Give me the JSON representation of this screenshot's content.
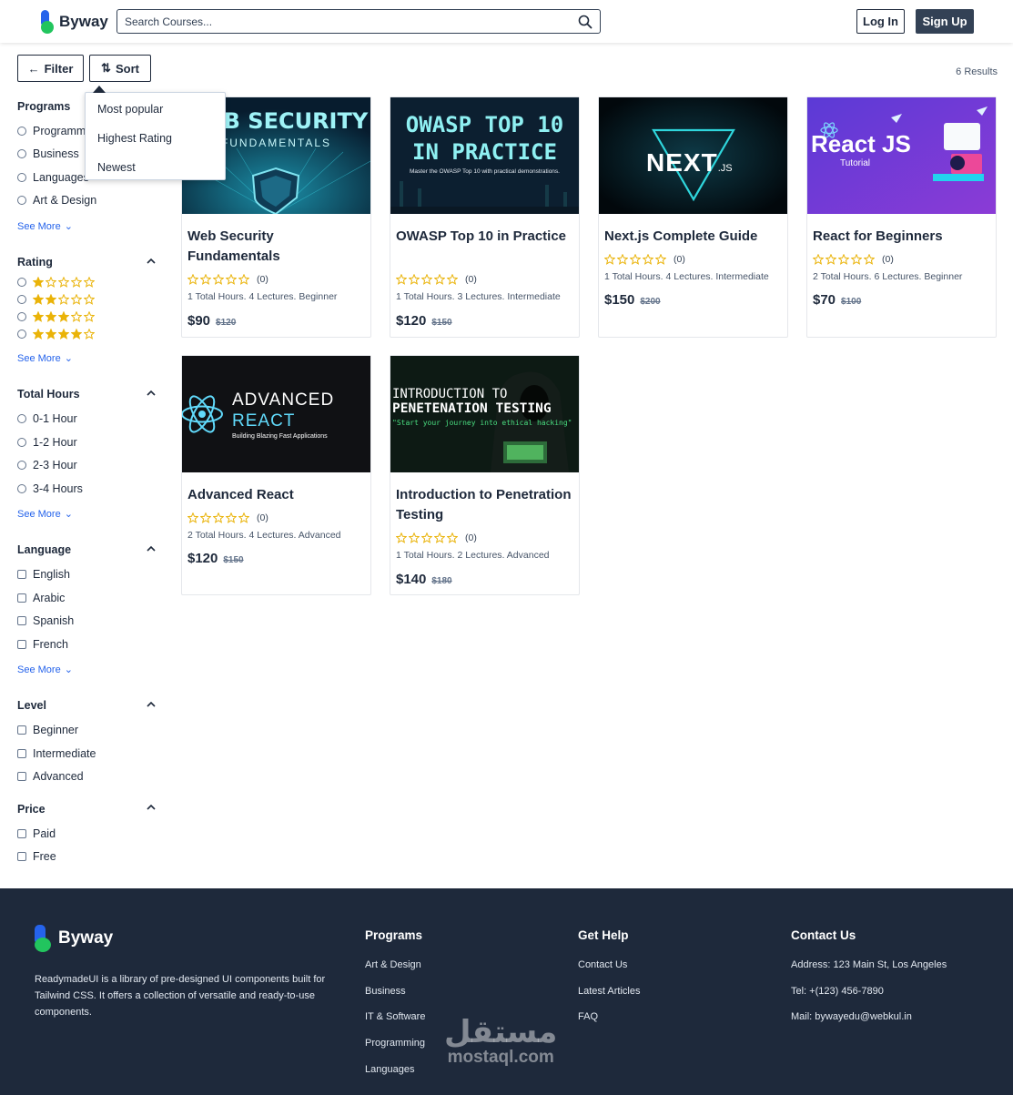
{
  "header": {
    "logo_text": "Byway",
    "search_placeholder": "Search Courses...",
    "login_label": "Log In",
    "signup_label": "Sign Up"
  },
  "toolbar": {
    "filter_label": "Filter",
    "sort_label": "Sort",
    "results": "6 Results"
  },
  "sort_menu": [
    "Most popular",
    "Highest Rating",
    "Newest"
  ],
  "sidebar": {
    "programs": {
      "title": "Programs",
      "options": [
        "Programming",
        "Business",
        "Languages",
        "Art & Design"
      ],
      "see_more": "See More"
    },
    "rating": {
      "title": "Rating",
      "levels": [
        1,
        2,
        3,
        4
      ],
      "see_more": "See More"
    },
    "hours": {
      "title": "Total Hours",
      "options": [
        "0-1 Hour",
        "1-2 Hour",
        "2-3 Hour",
        "3-4 Hours"
      ],
      "see_more": "See More"
    },
    "language": {
      "title": "Language",
      "options": [
        "English",
        "Arabic",
        "Spanish",
        "French"
      ],
      "see_more": "See More"
    },
    "level": {
      "title": "Level",
      "options": [
        "Beginner",
        "Intermediate",
        "Advanced"
      ]
    },
    "price": {
      "title": "Price",
      "options": [
        "Paid",
        "Free"
      ]
    }
  },
  "courses": [
    {
      "title": "Web Security Fundamentals",
      "img_line1": "WEB SECURITY",
      "img_line2": "FUNDAMENTALS",
      "rating_count": "(0)",
      "meta": "1 Total Hours. 4 Lectures. Beginner",
      "price": "$90",
      "old_price": "$120"
    },
    {
      "title": "OWASP Top 10 in Practice",
      "img_line1": "OWASP TOP 10",
      "img_line2": "IN PRACTICE",
      "img_sub": "Master the OWASP Top 10 with practical demonstrations.",
      "rating_count": "(0)",
      "meta": "1 Total Hours. 3 Lectures. Intermediate",
      "price": "$120",
      "old_price": "$150"
    },
    {
      "title": "Next.js Complete Guide",
      "img_line1": "NEXT",
      "img_line2": ".JS",
      "rating_count": "(0)",
      "meta": "1 Total Hours. 4 Lectures. Intermediate",
      "price": "$150",
      "old_price": "$200"
    },
    {
      "title": "React for Beginners",
      "img_line1": "React JS",
      "img_line2": "Tutorial",
      "rating_count": "(0)",
      "meta": "2 Total Hours. 6 Lectures. Beginner",
      "price": "$70",
      "old_price": "$100"
    },
    {
      "title": "Advanced React",
      "img_line1": "ADVANCED",
      "img_line2": "REACT",
      "img_sub": "Building Blazing Fast Applications",
      "rating_count": "(0)",
      "meta": "2 Total Hours. 4 Lectures. Advanced",
      "price": "$120",
      "old_price": "$150"
    },
    {
      "title": "Introduction to Penetration Testing",
      "img_line1": "INTRODUCTION TO",
      "img_line2": "PENETENATION TESTING",
      "img_sub": "\"Start your journey into ethical hacking\"",
      "rating_count": "(0)",
      "meta": "1 Total Hours. 2 Lectures. Advanced",
      "price": "$140",
      "old_price": "$180"
    }
  ],
  "footer": {
    "logo_text": "Byway",
    "description": "ReadymadeUI is a library of pre-designed UI components built for Tailwind CSS. It offers a collection of versatile and ready-to-use components.",
    "programs": {
      "title": "Programs",
      "links": [
        "Art & Design",
        "Business",
        "IT & Software",
        "Programming",
        "Languages"
      ]
    },
    "help": {
      "title": "Get Help",
      "links": [
        "Contact Us",
        "Latest Articles",
        "FAQ"
      ]
    },
    "contact": {
      "title": "Contact Us",
      "lines": [
        "Address: 123 Main St, Los Angeles",
        "Tel: +(123) 456-7890",
        "Mail: bywayedu@webkul.in"
      ]
    },
    "watermark_ar": "مستقل",
    "watermark_en": "mostaql.com"
  },
  "colors": {
    "primary": "#334155",
    "accent_blue": "#2563eb",
    "accent_green": "#22c55e",
    "star": "#eab308",
    "footer_bg": "#1e293b"
  }
}
